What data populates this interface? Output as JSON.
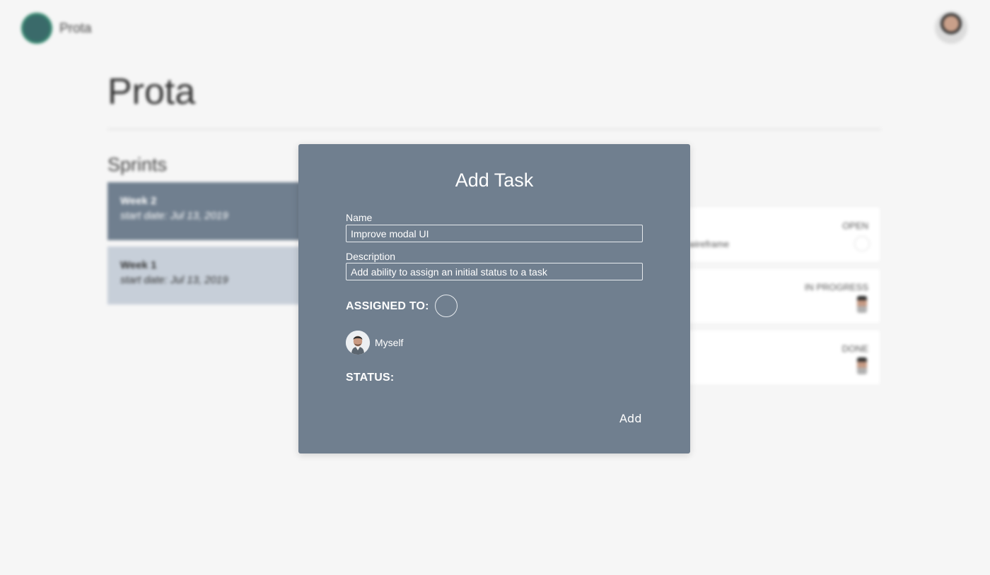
{
  "app": {
    "brand": "Prota",
    "page_title": "Prota"
  },
  "sprints": {
    "heading": "Sprints",
    "items": [
      {
        "name": "Week 2",
        "start_date": "start date: Jul 13, 2019"
      },
      {
        "name": "Week 1",
        "start_date": "start date: Jul 13, 2019"
      }
    ]
  },
  "tasks": [
    {
      "status": "OPEN",
      "text": "wireframe"
    },
    {
      "status": "IN PROGRESS",
      "text": ""
    },
    {
      "status": "DONE",
      "text": ""
    }
  ],
  "modal": {
    "title": "Add Task",
    "name_label": "Name",
    "name_value": "Improve modal UI",
    "description_label": "Description",
    "description_value": "Add ability to assign an initial status to a task",
    "assigned_label": "ASSIGNED TO:",
    "members": [
      {
        "name": "Myself"
      }
    ],
    "status_label": "STATUS:",
    "add_label": "Add"
  },
  "colors": {
    "modal_bg": "#707f8f",
    "active_sprint": "#707f8f",
    "inactive_sprint": "#c7cfd9",
    "page_bg": "#f6f6f6"
  },
  "icons": {
    "logo": "prota-logo",
    "user": "user-avatar"
  }
}
